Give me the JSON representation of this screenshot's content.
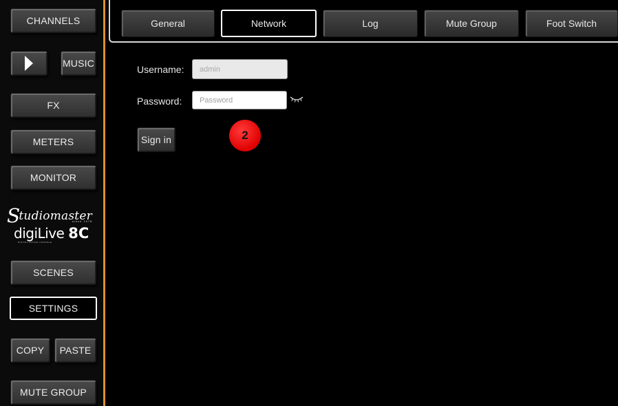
{
  "sidebar": {
    "channels": "CHANNELS",
    "music": "MUSIC",
    "fx": "FX",
    "meters": "METERS",
    "monitor": "MONITOR",
    "scenes": "SCENES",
    "settings": "SETTINGS",
    "copy": "COPY",
    "paste": "PASTE",
    "mute_group": "MUTE GROUP"
  },
  "logo": {
    "brand": "tudiomaster",
    "brand_initial": "S",
    "since": "since 1978",
    "product_prefix": "digiLive",
    "product_model": "8C",
    "product_sub": "DIGITAL MIXING CONSOLE"
  },
  "tabs": [
    {
      "label": "General",
      "active": false
    },
    {
      "label": "Network",
      "active": true
    },
    {
      "label": "Log",
      "active": false
    },
    {
      "label": "Mute Group",
      "active": false
    },
    {
      "label": "Foot Switch",
      "active": false
    }
  ],
  "form": {
    "username_label": "Username:",
    "username_value": "admin",
    "password_label": "Password:",
    "password_placeholder": "Password",
    "signin_label": "Sign in"
  },
  "annotation": {
    "badge": "2"
  },
  "colors": {
    "accent_divider": "#e0902c",
    "badge": "#e00000"
  }
}
